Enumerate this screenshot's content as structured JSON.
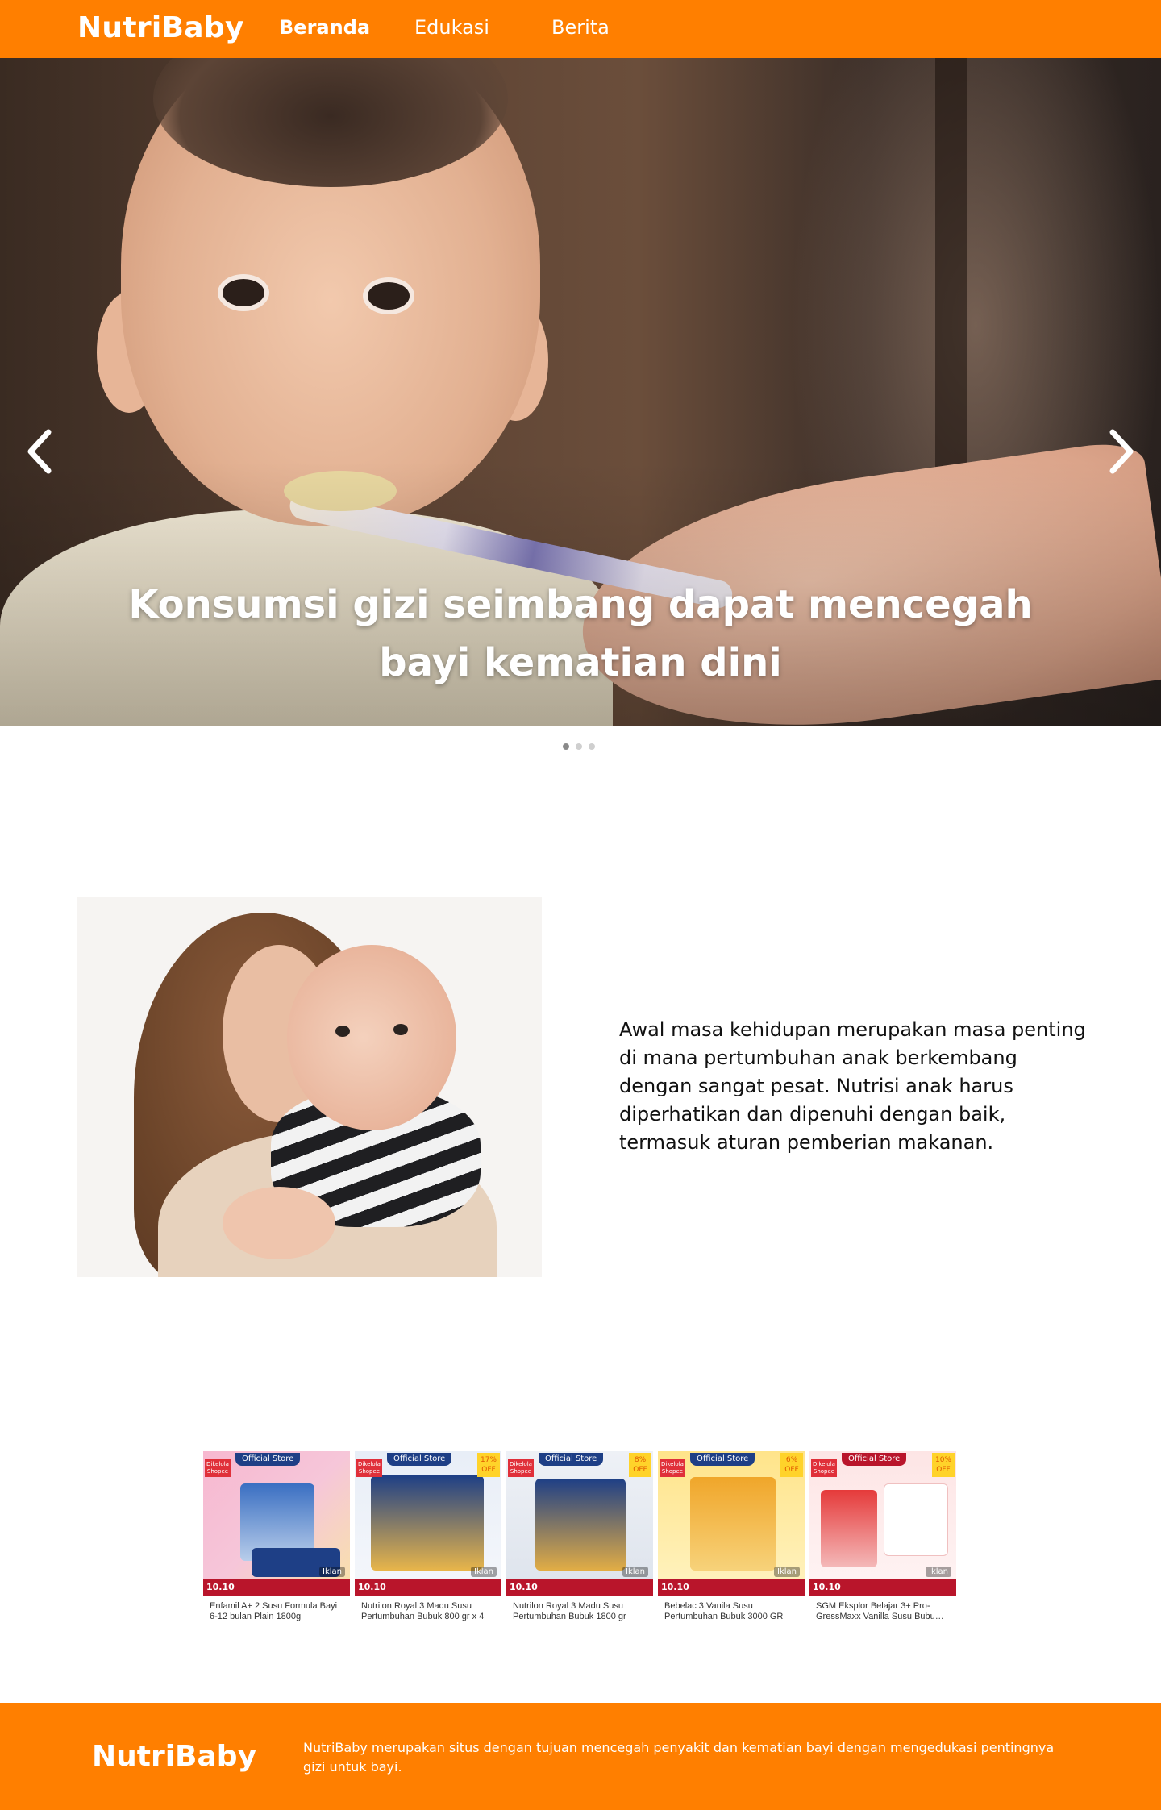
{
  "navbar": {
    "brand": "NutriBaby",
    "links": [
      {
        "label": "Beranda"
      },
      {
        "label": "Edukasi"
      },
      {
        "label": "Berita"
      }
    ]
  },
  "hero": {
    "caption": "Konsumsi gizi seimbang dapat mencegah bayi kematian dini",
    "slides_total": 3,
    "active_slide": 1
  },
  "info": {
    "text": "Awal masa kehidupan merupakan masa penting di mana pertumbuhan anak berkembang dengan sangat pesat. Nutrisi anak harus diperhatikan dan dipenuhi dengan baik, termasuk aturan pemberian makanan."
  },
  "products": [
    {
      "name": "Enfamil A+ 2 Susu Formula Bayi 6-12 bulan Plain 1800g",
      "store": "Official Store",
      "managed": "Dikelola Shopee",
      "discount": "",
      "promo": "10.10",
      "ad": "Iklan"
    },
    {
      "name": "Nutrilon Royal 3 Madu Susu Pertumbuhan Bubuk 800 gr x 4",
      "store": "Official Store",
      "managed": "Dikelola Shopee",
      "discount": "17% OFF",
      "promo": "10.10",
      "ad": "Iklan"
    },
    {
      "name": "Nutrilon Royal 3 Madu Susu Pertumbuhan Bubuk 1800 gr",
      "store": "Official Store",
      "managed": "Dikelola Shopee",
      "discount": "8% OFF",
      "promo": "10.10",
      "ad": "Iklan"
    },
    {
      "name": "Bebelac 3 Vanila Susu Pertumbuhan Bubuk 3000 GR",
      "store": "Official Store",
      "managed": "Dikelola Shopee",
      "discount": "6% OFF",
      "promo": "10.10",
      "ad": "Iklan"
    },
    {
      "name": "SGM Eksplor Belajar 3+ Pro-GressMaxx Vanilla Susu Bubu…",
      "store": "Official Store",
      "managed": "Dikelola Shopee",
      "discount": "10% OFF",
      "promo": "10.10",
      "ad": "Iklan"
    }
  ],
  "footer": {
    "brand": "NutriBaby",
    "text": "NutriBaby merupakan situs dengan tujuan mencegah penyakit dan kematian bayi dengan mengedukasi pentingnya gizi untuk bayi."
  },
  "colors": {
    "brand_orange": "#ff7f00",
    "promo_red": "#b9152b",
    "store_blue": "#1e3f86"
  },
  "icons": [
    "chevron-left-icon",
    "chevron-right-icon"
  ]
}
